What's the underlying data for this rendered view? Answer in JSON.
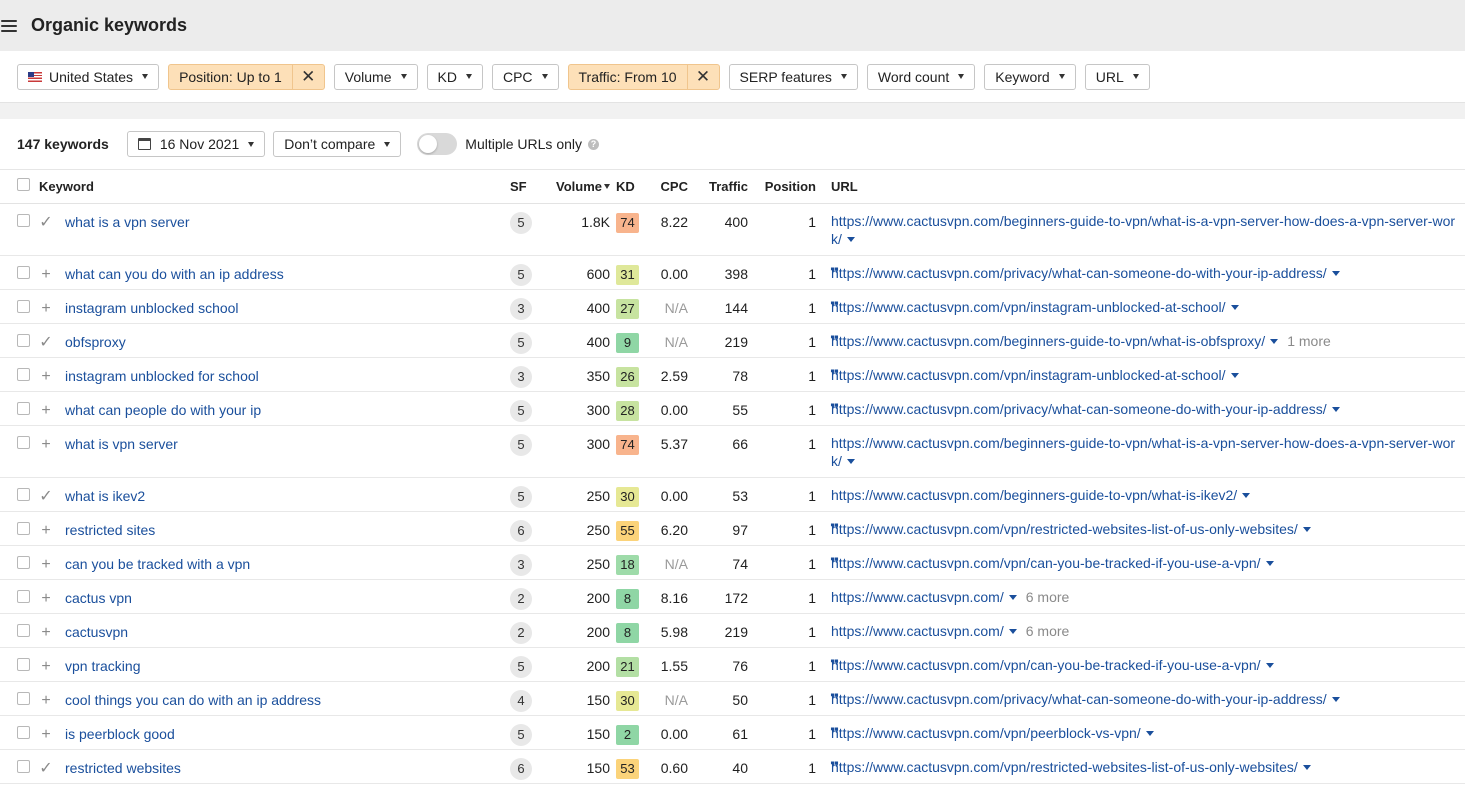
{
  "header": {
    "title": "Organic keywords"
  },
  "filters": {
    "country": "United States",
    "position": "Position: Up to 1",
    "volume": "Volume",
    "kd": "KD",
    "cpc": "CPC",
    "traffic": "Traffic: From 10",
    "serp": "SERP features",
    "word_count": "Word count",
    "keyword": "Keyword",
    "url": "URL",
    "clear_icon": "✕"
  },
  "controls": {
    "count": "147 keywords",
    "date": "16 Nov 2021",
    "compare": "Don’t compare",
    "multiple_urls": "Multiple URLs only",
    "help": "?"
  },
  "columns": {
    "keyword": "Keyword",
    "sf": "SF",
    "volume": "Volume",
    "kd": "KD",
    "cpc": "CPC",
    "traffic": "Traffic",
    "position": "Position",
    "url": "URL"
  },
  "kd_colors": {
    "74": "#f8b48d",
    "31": "#dfe89a",
    "27": "#c7e3a0",
    "9": "#8fd6a5",
    "26": "#c7e3a0",
    "28": "#c7e3a0",
    "30": "#e6e894",
    "55": "#fbd37a",
    "18": "#9edba9",
    "8": "#8fd6a5",
    "21": "#b3dfa4",
    "2": "#8fd6a5",
    "53": "#fbd37a"
  },
  "rows": [
    {
      "mark": "✓",
      "keyword": "what is a vpn server",
      "sf": "5",
      "volume": "1.8K",
      "kd": "74",
      "cpc": "8.22",
      "traffic": "400",
      "position": "1",
      "quote": "",
      "url": "https://www.cactusvpn.com/beginners-guide-to-vpn/what-is-a-vpn-server-how-does-a-vpn-server-work/",
      "more": "",
      "tall": true
    },
    {
      "mark": "+",
      "keyword": "what can you do with an ip address",
      "sf": "5",
      "volume": "600",
      "kd": "31",
      "cpc": "0.00",
      "traffic": "398",
      "position": "1",
      "quote": "❞",
      "url": "https://www.cactusvpn.com/privacy/what-can-someone-do-with-your-ip-address/",
      "more": ""
    },
    {
      "mark": "+",
      "keyword": "instagram unblocked school",
      "sf": "3",
      "volume": "400",
      "kd": "27",
      "cpc": "N/A",
      "traffic": "144",
      "position": "1",
      "quote": "❞",
      "url": "https://www.cactusvpn.com/vpn/instagram-unblocked-at-school/",
      "more": ""
    },
    {
      "mark": "✓",
      "keyword": "obfsproxy",
      "sf": "5",
      "volume": "400",
      "kd": "9",
      "cpc": "N/A",
      "traffic": "219",
      "position": "1",
      "quote": "❞",
      "url": "https://www.cactusvpn.com/beginners-guide-to-vpn/what-is-obfsproxy/",
      "more": "1 more"
    },
    {
      "mark": "+",
      "keyword": "instagram unblocked for school",
      "sf": "3",
      "volume": "350",
      "kd": "26",
      "cpc": "2.59",
      "traffic": "78",
      "position": "1",
      "quote": "❞",
      "url": "https://www.cactusvpn.com/vpn/instagram-unblocked-at-school/",
      "more": ""
    },
    {
      "mark": "+",
      "keyword": "what can people do with your ip",
      "sf": "5",
      "volume": "300",
      "kd": "28",
      "cpc": "0.00",
      "traffic": "55",
      "position": "1",
      "quote": "❞",
      "url": "https://www.cactusvpn.com/privacy/what-can-someone-do-with-your-ip-address/",
      "more": ""
    },
    {
      "mark": "+",
      "keyword": "what is vpn server",
      "sf": "5",
      "volume": "300",
      "kd": "74",
      "cpc": "5.37",
      "traffic": "66",
      "position": "1",
      "quote": "",
      "url": "https://www.cactusvpn.com/beginners-guide-to-vpn/what-is-a-vpn-server-how-does-a-vpn-server-work/",
      "more": "",
      "tall": true
    },
    {
      "mark": "✓",
      "keyword": "what is ikev2",
      "sf": "5",
      "volume": "250",
      "kd": "30",
      "cpc": "0.00",
      "traffic": "53",
      "position": "1",
      "quote": "",
      "url": "https://www.cactusvpn.com/beginners-guide-to-vpn/what-is-ikev2/",
      "more": ""
    },
    {
      "mark": "+",
      "keyword": "restricted sites",
      "sf": "6",
      "volume": "250",
      "kd": "55",
      "cpc": "6.20",
      "traffic": "97",
      "position": "1",
      "quote": "❞",
      "url": "https://www.cactusvpn.com/vpn/restricted-websites-list-of-us-only-websites/",
      "more": ""
    },
    {
      "mark": "+",
      "keyword": "can you be tracked with a vpn",
      "sf": "3",
      "volume": "250",
      "kd": "18",
      "cpc": "N/A",
      "traffic": "74",
      "position": "1",
      "quote": "❞",
      "url": "https://www.cactusvpn.com/vpn/can-you-be-tracked-if-you-use-a-vpn/",
      "more": ""
    },
    {
      "mark": "+",
      "keyword": "cactus vpn",
      "sf": "2",
      "volume": "200",
      "kd": "8",
      "cpc": "8.16",
      "traffic": "172",
      "position": "1",
      "quote": "",
      "url": "https://www.cactusvpn.com/",
      "more": "6 more"
    },
    {
      "mark": "+",
      "keyword": "cactusvpn",
      "sf": "2",
      "volume": "200",
      "kd": "8",
      "cpc": "5.98",
      "traffic": "219",
      "position": "1",
      "quote": "",
      "url": "https://www.cactusvpn.com/",
      "more": "6 more"
    },
    {
      "mark": "+",
      "keyword": "vpn tracking",
      "sf": "5",
      "volume": "200",
      "kd": "21",
      "cpc": "1.55",
      "traffic": "76",
      "position": "1",
      "quote": "❞",
      "url": "https://www.cactusvpn.com/vpn/can-you-be-tracked-if-you-use-a-vpn/",
      "more": ""
    },
    {
      "mark": "+",
      "keyword": "cool things you can do with an ip address",
      "sf": "4",
      "volume": "150",
      "kd": "30",
      "cpc": "N/A",
      "traffic": "50",
      "position": "1",
      "quote": "❞",
      "url": "https://www.cactusvpn.com/privacy/what-can-someone-do-with-your-ip-address/",
      "more": ""
    },
    {
      "mark": "+",
      "keyword": "is peerblock good",
      "sf": "5",
      "volume": "150",
      "kd": "2",
      "cpc": "0.00",
      "traffic": "61",
      "position": "1",
      "quote": "❞",
      "url": "https://www.cactusvpn.com/vpn/peerblock-vs-vpn/",
      "more": ""
    },
    {
      "mark": "✓",
      "keyword": "restricted websites",
      "sf": "6",
      "volume": "150",
      "kd": "53",
      "cpc": "0.60",
      "traffic": "40",
      "position": "1",
      "quote": "❞",
      "url": "https://www.cactusvpn.com/vpn/restricted-websites-list-of-us-only-websites/",
      "more": ""
    }
  ]
}
